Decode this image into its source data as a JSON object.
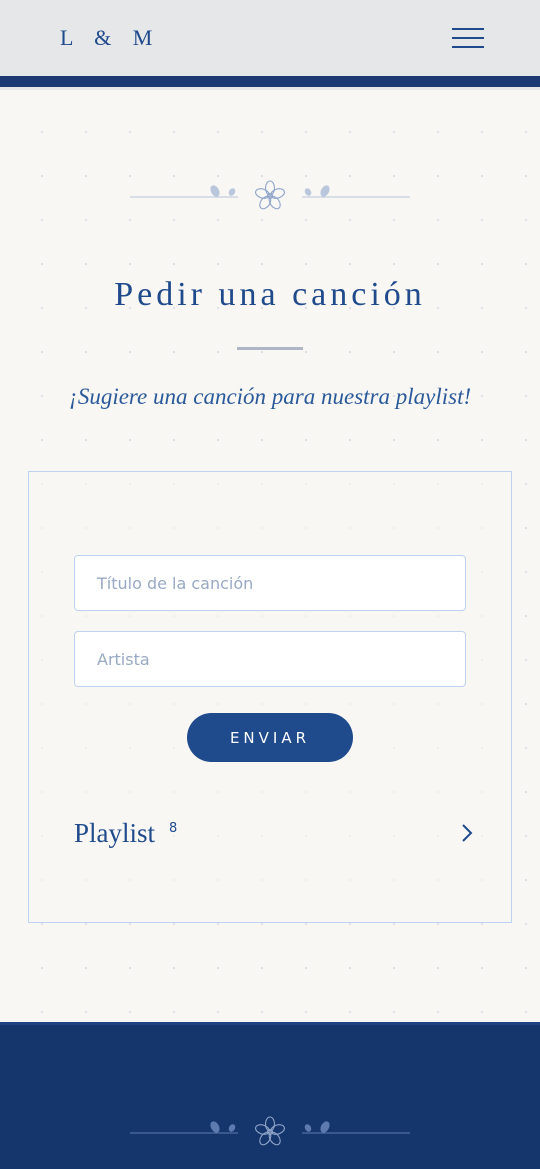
{
  "header": {
    "logo": "L & M",
    "menu_icon": "hamburger-menu-icon"
  },
  "ornament": {
    "icon": "flower-ornament-icon"
  },
  "section": {
    "title": "Pedir una canción",
    "subtitle": "¡Sugiere una canción para nuestra playlist!"
  },
  "form": {
    "song_placeholder": "Título de la canción",
    "song_value": "",
    "artist_placeholder": "Artista",
    "artist_value": "",
    "submit_label": "ENVIAR"
  },
  "playlist": {
    "label": "Playlist",
    "count": "8",
    "chevron_icon": "chevron-right-icon"
  },
  "colors": {
    "primary": "#1f4a8c",
    "footer": "#15356d",
    "background": "#f8f7f4",
    "header": "#e6e7e8"
  }
}
